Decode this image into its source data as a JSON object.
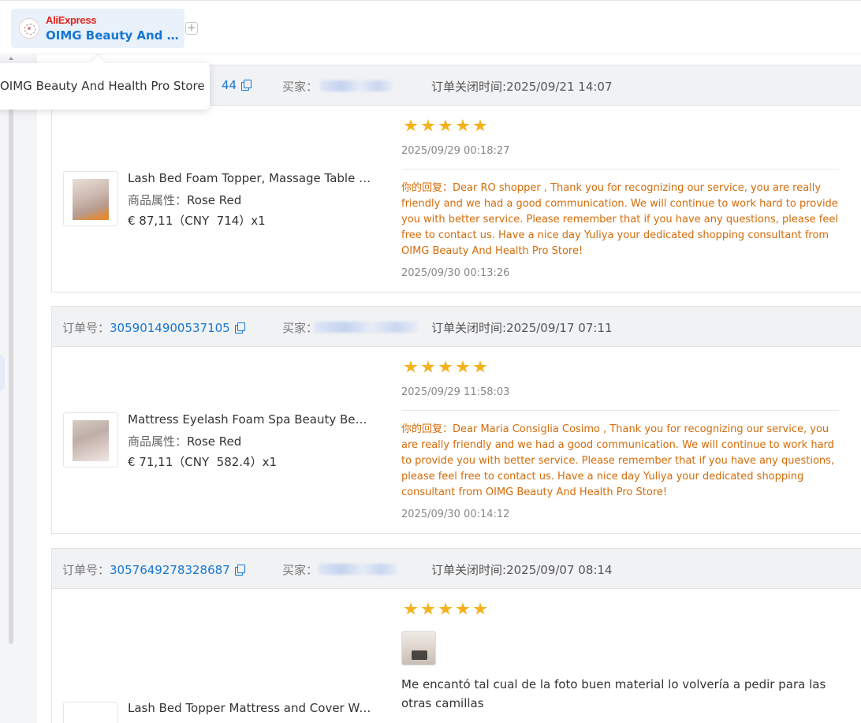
{
  "store_tab": {
    "platform": "AliExpress",
    "name": "OIMG Beauty And H...",
    "add_label": "+"
  },
  "tooltip": {
    "text": "OIMG Beauty And Health Pro Store"
  },
  "labels": {
    "order_no": "订单号：",
    "buyer": "买家：",
    "close_time": "订单关闭时间:",
    "attr": "商品属性：",
    "reply_prefix": "你的回复："
  },
  "orders": [
    {
      "order_no": "44",
      "close_time": "2025/09/21 14:07",
      "product": {
        "title": "Lash Bed Foam Topper, Massage Table H...",
        "attr": "Rose Red",
        "price": "€ 87,11（CNY  714）x1"
      },
      "rating": 5,
      "review_time": "2025/09/29 00:18:27",
      "reply": "Dear RO shopper , Thank you for recognizing our service, you are really friendly and we had a good communication. We will continue to work hard to provide you with better service. Please remember that if you have any questions, please feel free to contact us. Have a nice day Yuliya your dedicated shopping consultant from OIMG Beauty And Health Pro Store!",
      "reply_time": "2025/09/30 00:13:26"
    },
    {
      "order_no": "3059014900537105",
      "close_time": "2025/09/17 07:11",
      "product": {
        "title": "Mattress Eyelash Foam Spa Beauty Bed ...",
        "attr": "Rose Red",
        "price": "€ 71,11（CNY  582.4）x1"
      },
      "rating": 5,
      "review_time": "2025/09/29 11:58:03",
      "reply": "Dear Maria Consiglia Cosimo , Thank you for recognizing our service, you are really friendly and we had a good communication. We will continue to work hard to provide you with better service. Please remember that if you have any questions, please feel free to contact us. Have a nice day Yuliya your dedicated shopping consultant from OIMG Beauty And Health Pro Store!",
      "reply_time": "2025/09/30 00:14:12"
    },
    {
      "order_no": "3057649278328687",
      "close_time": "2025/09/07 08:14",
      "product": {
        "title": "Lash Bed Topper Mattress and Cover Wa..."
      },
      "rating": 5,
      "review_text": "Me encantó tal cual de la foto buen material lo volvería a pedir para las otras camillas"
    }
  ],
  "colors": {
    "link_blue": "#1677d2",
    "reply_orange": "#d46b08",
    "star_gold": "#f5b11c",
    "header_gray": "#f1f2f4"
  }
}
